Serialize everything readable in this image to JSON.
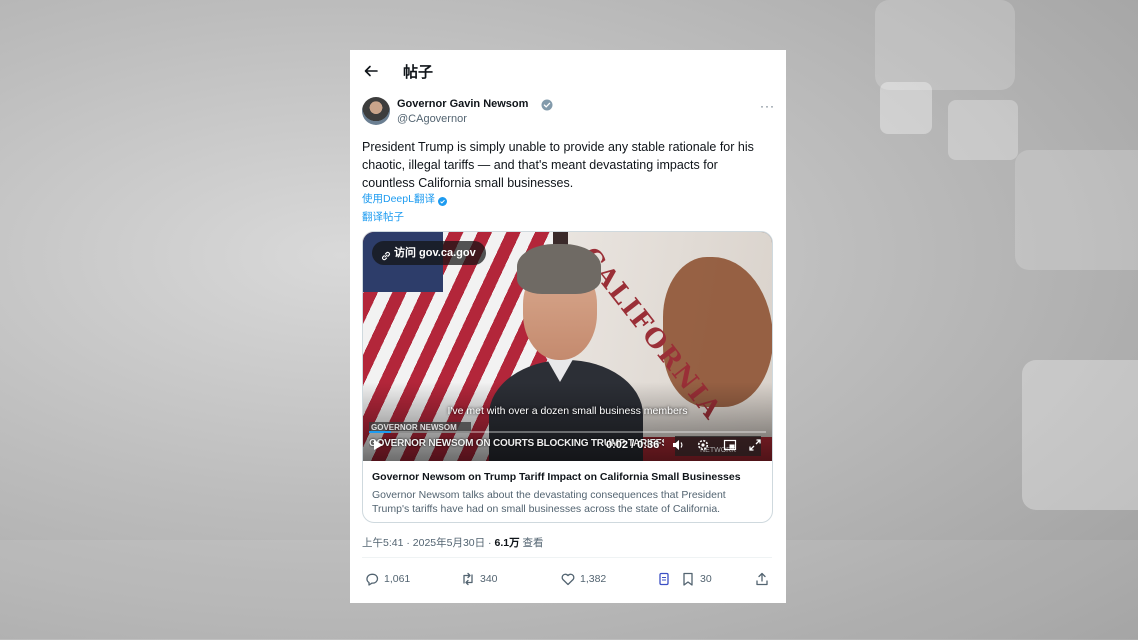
{
  "header": {
    "title": "帖子",
    "back_icon": "back-arrow-icon"
  },
  "author": {
    "name": "Governor Gavin Newsom",
    "handle": "@CAgovernor",
    "verified_color": "#829aab",
    "more_icon_label": "···"
  },
  "post": {
    "text": "President Trump is simply unable to provide any stable rationale for his chaotic, illegal tariffs — and that's meant devastating impacts for countless California small businesses.",
    "translate_deepl": "使用DeepL翻译",
    "translate_post": "翻译帖子",
    "link_color": "#1d9bf0"
  },
  "media": {
    "visit_label": "访问 gov.ca.gov",
    "subtitle": "I've met with over a dozen small business members",
    "lower_third_small": "GOVERNOR NEWSOM",
    "lower_third": "GOVERNOR NEWSOM ON COURTS BLOCKING TRUMP TARIFFS",
    "network": "NETWORK",
    "time": "0:02 / 0:36",
    "progress": 0.056,
    "card_title": "Governor Newsom on Trump Tariff Impact on California Small Businesses",
    "card_desc": "Governor Newsom talks about the devastating consequences that President Trump's tariffs have had on small businesses across the state of California."
  },
  "meta": {
    "timestamp": "上午5:41 · 2025年5月30日 · ",
    "views": "6.1万",
    "views_label": " 查看"
  },
  "actions": {
    "replies": "1,061",
    "reposts": "340",
    "likes": "1,382",
    "bookmarks": "30"
  }
}
